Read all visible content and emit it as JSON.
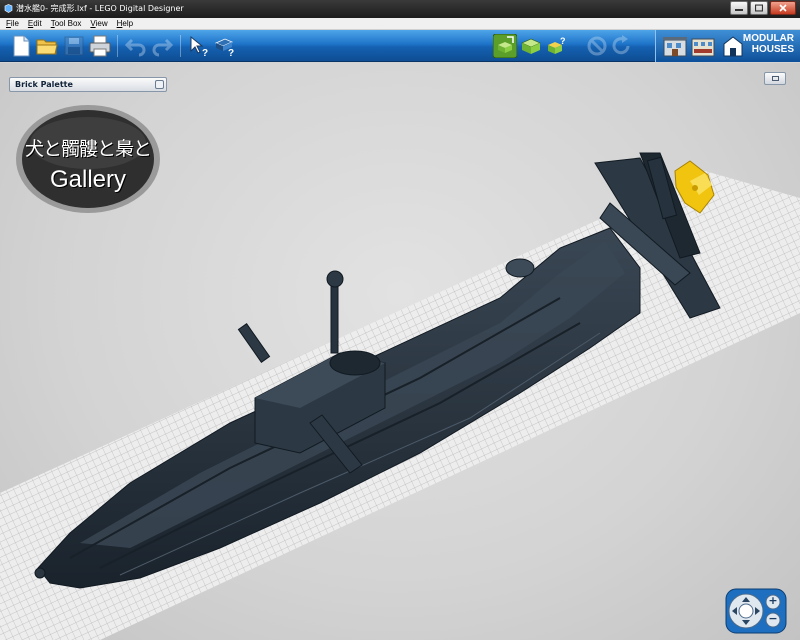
{
  "window": {
    "title": "潜水艦0- 完成形.lxf - LEGO Digital Designer",
    "app_icon": "ldd-app-icon",
    "controls": [
      "minimize-icon",
      "maximize-icon",
      "close-icon"
    ]
  },
  "menu": {
    "items": [
      "File",
      "Edit",
      "Tool Box",
      "View",
      "Help"
    ]
  },
  "toolbar": {
    "tools": [
      "new-file-icon",
      "open-folder-icon",
      "save-disk-icon",
      "print-icon",
      "undo-icon",
      "redo-icon",
      "help-pointer-icon",
      "help-tour-icon",
      "build-mode-icon",
      "view-mode-icon",
      "building-guide-icon",
      "share-icon",
      "refresh-icon"
    ],
    "theme_label_line1": "MODULAR",
    "theme_label_line2": "HOUSES",
    "accent": "#1e74c9"
  },
  "viewport": {
    "brick_palette_label": "Brick Palette",
    "logo": {
      "line1": "犬と髑髏と梟と",
      "line2": "Gallery"
    },
    "model_color": "#26323d",
    "highlight_color": "#f1c40f",
    "grid_color": "#b8b8b8"
  },
  "camera_control": {
    "zoom_in": "+",
    "zoom_out": "−"
  }
}
